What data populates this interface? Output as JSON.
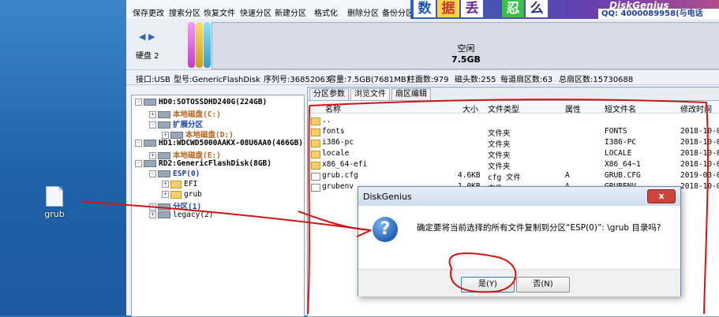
{
  "desktop": {
    "icon_label": "grub"
  },
  "toolbar": {
    "buttons": [
      "保存更改",
      "搜索分区",
      "恢复文件",
      "快速分区",
      "新建分区",
      "格式化",
      "删除分区",
      "备份分区"
    ]
  },
  "banner": {
    "tiles": [
      "数",
      "据",
      "丢",
      "忍",
      "么"
    ],
    "brand": "DiskGenius",
    "qq": "QQ: 4000089958(与电话"
  },
  "diskbar": {
    "arrows": "◀ ▶",
    "disk_label": "硬盘 2",
    "free_label": "空闲",
    "free_size": "7.5GB"
  },
  "infobar": {
    "interface": "接口:USB",
    "model": "型号:GenericFlashDisk",
    "serial": "序列号:36852063",
    "capacity": "容量:7.5GB(7681MB)",
    "cylinders": "柱面数:979",
    "heads": "磁头数:255",
    "sectors": "每道扇区数:63",
    "total_sectors": "总扇区数:15730688"
  },
  "tree": {
    "hd0": "HD0:SOTOSSDHD240G(224GB)",
    "hd0_c": "本地磁盘(C:)",
    "hd0_ext": "扩展分区",
    "hd0_d": "本地磁盘(D:)",
    "hd1": "HD1:WDCWD5000AAKX-08U6AA0(466GB)",
    "hd1_e": "本地磁盘(E:)",
    "rd2": "RD2:GenericFlashDisk(8GB)",
    "esp": "ESP(0)",
    "efi": "EFI",
    "grub": "grub",
    "part1": "分区(1)",
    "legacy": "legacy(2)"
  },
  "tabs": [
    "分区参数",
    "浏览文件",
    "扇区编辑"
  ],
  "file_headers": {
    "name": "名称",
    "size": "大小",
    "type": "文件类型",
    "attr": "属性",
    "short": "短文件名",
    "modified": "修改时间"
  },
  "files": [
    {
      "name": "..",
      "size": "",
      "type": "",
      "attr": "",
      "short": "",
      "modified": ""
    },
    {
      "name": "fonts",
      "size": "",
      "type": "文件夹",
      "attr": "",
      "short": "FONTS",
      "modified": "2018-10-0"
    },
    {
      "name": "i386-pc",
      "size": "",
      "type": "文件夹",
      "attr": "",
      "short": "I386-PC",
      "modified": "2018-10-0"
    },
    {
      "name": "locale",
      "size": "",
      "type": "文件夹",
      "attr": "",
      "short": "LOCALE",
      "modified": "2018-10-0"
    },
    {
      "name": "x86_64-efi",
      "size": "",
      "type": "文件夹",
      "attr": "",
      "short": "X86_64~1",
      "modified": "2018-10-0"
    },
    {
      "name": "grub.cfg",
      "size": "4.6KB",
      "type": "cfg 文件",
      "attr": "A",
      "short": "GRUB.CFG",
      "modified": "2019-03-0"
    },
    {
      "name": "grubenv",
      "size": "1.0KB",
      "type": "文件",
      "attr": "A",
      "short": "GRUBENV",
      "modified": "2018-10-0"
    }
  ],
  "dialog": {
    "title": "DiskGenius",
    "close": "x",
    "message": "确定要将当前选择的所有文件复制到分区“ESP(0)”: \\grub 目录吗?",
    "yes": "是(Y)",
    "no": "否(N)"
  }
}
